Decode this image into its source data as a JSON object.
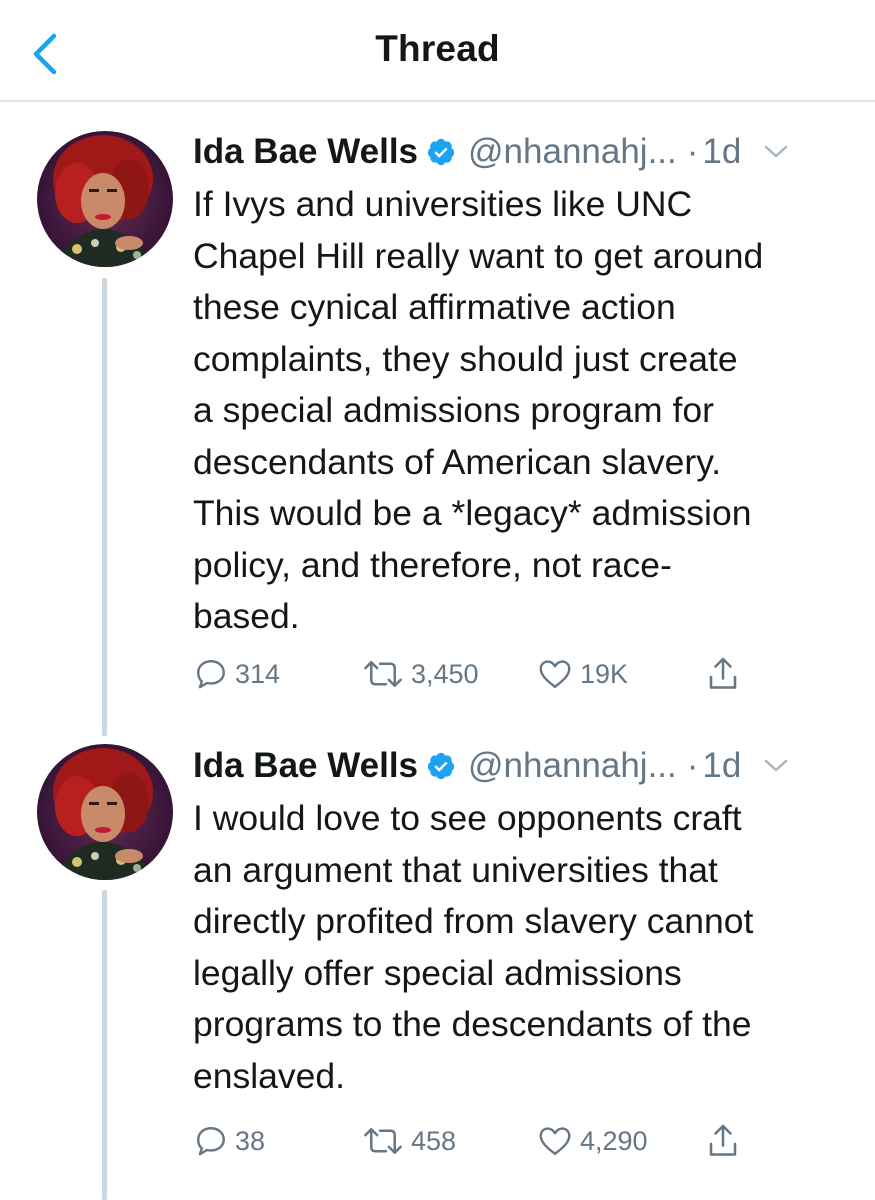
{
  "header": {
    "title": "Thread"
  },
  "tweets": [
    {
      "name": "Ida Bae Wells",
      "handle": "@nhannahj...",
      "dot": "·",
      "time": "1d",
      "lines": [
        "If Ivys and universities like UNC",
        "Chapel Hill really want to get around",
        "these cynical affirmative action",
        "complaints, they should just create",
        "a special admissions program for",
        "descendants of American slavery.",
        "This would be a *legacy* admission",
        "policy, and therefore, not race-",
        "based."
      ],
      "replies": "314",
      "retweets": "3,450",
      "likes": "19K"
    },
    {
      "name": "Ida Bae Wells",
      "handle": "@nhannahj...",
      "dot": "·",
      "time": "1d",
      "lines": [
        "I would love to see opponents craft",
        "an argument that universities that",
        "directly profited from slavery cannot",
        "legally offer special admissions",
        "programs to the descendants of the",
        "enslaved."
      ],
      "replies": "38",
      "retweets": "458",
      "likes": "4,290"
    }
  ],
  "colors": {
    "accent": "#1da1f2",
    "secondary_text": "#657786",
    "divider": "#e1e8ed",
    "thread_line": "#ccd6dd"
  },
  "icons": [
    "back-chevron-icon",
    "verified-badge-icon",
    "caret-down-icon",
    "reply-icon",
    "retweet-icon",
    "like-heart-icon",
    "share-icon"
  ]
}
